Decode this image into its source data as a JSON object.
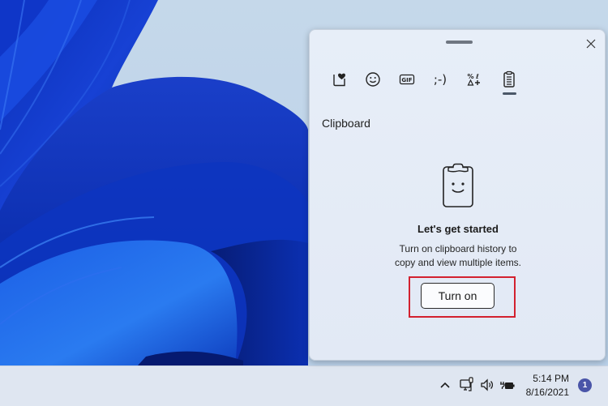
{
  "panel": {
    "title": "Clipboard",
    "tabs": [
      {
        "id": "kaomoji-favorites",
        "icon": "favorites-heart-icon",
        "label": "Recently used"
      },
      {
        "id": "emoji",
        "icon": "emoji-icon",
        "label": "Emoji"
      },
      {
        "id": "gif",
        "icon": "gif-icon",
        "label": "GIF",
        "glyph": "GIF"
      },
      {
        "id": "kaomoji",
        "icon": "kaomoji-icon",
        "label": "Kaomoji",
        "glyph": ";-)"
      },
      {
        "id": "symbols",
        "icon": "symbols-icon",
        "label": "Symbols"
      },
      {
        "id": "clipboard",
        "icon": "clipboard-icon",
        "label": "Clipboard",
        "selected": true
      }
    ],
    "empty_state": {
      "heading": "Let's get started",
      "description_line1": "Turn on clipboard history to",
      "description_line2": "copy and view multiple items.",
      "button_label": "Turn on"
    },
    "highlight_color": "#d3212f"
  },
  "taskbar": {
    "clock": {
      "time": "5:14 PM",
      "date": "8/16/2021"
    },
    "notification_count": "1",
    "tray_icons": [
      "chevron-up-icon",
      "network-icon",
      "volume-icon",
      "battery-charging-icon"
    ]
  }
}
